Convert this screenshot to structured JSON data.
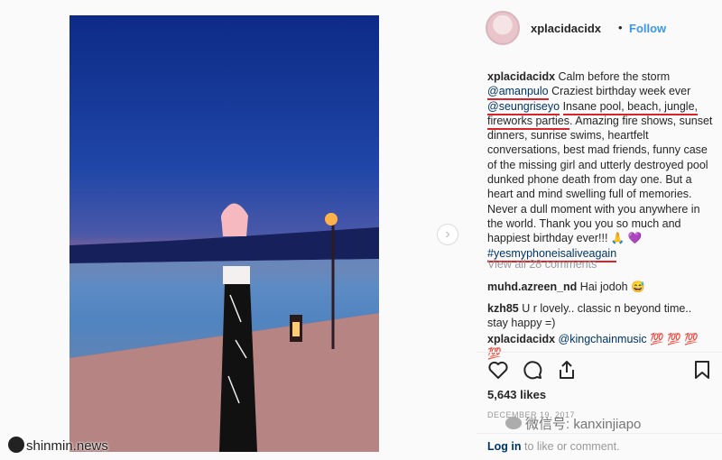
{
  "post": {
    "username": "xplacidacidx",
    "dot": "•",
    "follow_label": "Follow",
    "caption_parts": {
      "text1": " Calm before the storm ",
      "mention1": "@amanpulo",
      "text2": " Craziest birthday week ever ",
      "mention2": "@seungriseyo",
      "text3": " ",
      "highlight": "Insane pool, beach, jungle, fireworks parties",
      "text4": ". Amazing fire shows, sunset dinners, sunrise swims, heartfelt conversations, best mad friends, funny case of the missing girl and utterly destroyed pool dunked phone death from day one. But a heart and mind swelling full of memories. Never a dull moment with you anywhere in the world. Thank you you so much and happiest birthday ever!!! 🙏 💜 ",
      "hashtag": "#yesmyphoneisaliveagain"
    },
    "view_all_comments": "View all 28 comments",
    "comments": [
      {
        "user": "muhd.azreen_nd",
        "text": " Hai jodoh 😅"
      },
      {
        "user": "kzh85",
        "text": " U r lovely.. classic n beyond time.. stay happy =)"
      },
      {
        "user": "xplacidacidx",
        "mention": "@kingchainmusic",
        "text": " 💯 💯 💯 💯"
      }
    ],
    "likes": "5,643 likes",
    "date": "DECEMBER 19, 2017",
    "login_link": "Log in",
    "login_text": " to like or comment."
  },
  "watermarks": {
    "site": "shinmin.news",
    "wechat": "微信号: kanxinjiapo"
  },
  "icons": {
    "like": "heart-icon",
    "comment": "comment-icon",
    "share": "share-icon",
    "save": "bookmark-icon",
    "next": "chevron-right-icon"
  },
  "colors": {
    "accent": "#3897f0",
    "link": "#003569",
    "underline": "#d8232a",
    "muted": "#999999"
  }
}
